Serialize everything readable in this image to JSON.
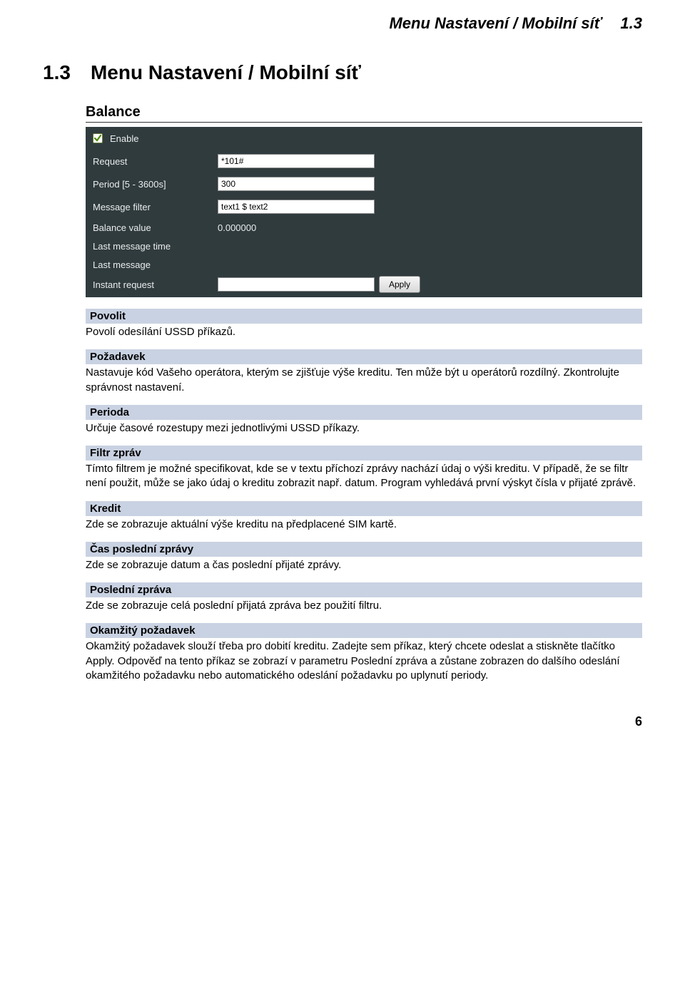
{
  "header": {
    "title": "Menu Nastavení / Mobilní síť",
    "version": "1.3"
  },
  "section": {
    "number": "1.3",
    "title": "Menu Nastavení / Mobilní síť"
  },
  "balance_heading": "Balance",
  "panel": {
    "enable_label": "Enable",
    "request_label": "Request",
    "request_value": "*101#",
    "period_label": "Period [5 - 3600s]",
    "period_value": "300",
    "msgfilter_label": "Message filter",
    "msgfilter_value": "text1 $ text2",
    "balancevalue_label": "Balance value",
    "balancevalue_value": "0.000000",
    "lastmsgtime_label": "Last message time",
    "lastmsgtime_value": "",
    "lastmsg_label": "Last message",
    "lastmsg_value": "",
    "instant_label": "Instant request",
    "apply_label": "Apply"
  },
  "terms": {
    "povolit": {
      "head": "Povolit",
      "body": "Povolí odesílání USSD příkazů."
    },
    "pozadavek": {
      "head": "Požadavek",
      "body": "Nastavuje kód Vašeho operátora, kterým se zjišťuje výše kreditu. Ten může být u operátorů rozdílný. Zkontrolujte správnost nastavení."
    },
    "perioda": {
      "head": "Perioda",
      "body": "Určuje časové rozestupy mezi jednotlivými USSD příkazy."
    },
    "filtr": {
      "head": "Filtr zpráv",
      "body": "Tímto filtrem je možné specifikovat, kde se v textu příchozí zprávy nachází údaj o výši kreditu. V případě, že se filtr není použit, může se jako údaj o kreditu zobrazit např. datum. Program vyhledává první výskyt čísla v přijaté zprávě."
    },
    "kredit": {
      "head": "Kredit",
      "body": "Zde se zobrazuje aktuální výše kreditu na předplacené SIM kartě."
    },
    "cas": {
      "head": "Čas poslední zprávy",
      "body": "Zde se zobrazuje datum a čas poslední přijaté zprávy."
    },
    "posledni": {
      "head": "Poslední zpráva",
      "body": "Zde se zobrazuje celá poslední přijatá zpráva bez použití filtru."
    },
    "okamzity": {
      "head": "Okamžitý požadavek",
      "body": "Okamžitý požadavek slouží třeba pro dobití kreditu. Zadejte sem příkaz, který chcete odeslat a stiskněte tlačítko Apply. Odpověď na tento příkaz se zobrazí v parametru Poslední zpráva a zůstane zobrazen do dalšího odeslání okamžitého požadavku nebo automatického odeslání požadavku po uplynutí periody."
    }
  },
  "page_number": "6"
}
